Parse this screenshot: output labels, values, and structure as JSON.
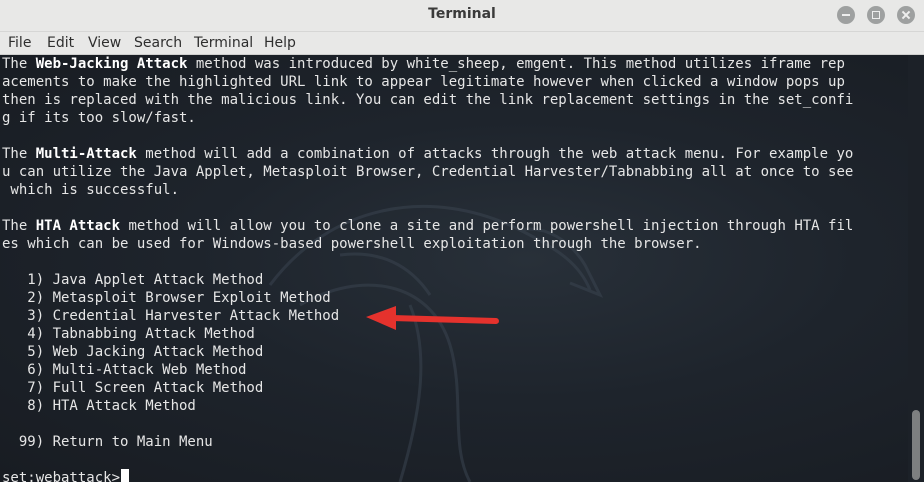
{
  "window": {
    "title": "Terminal",
    "controls": [
      "minimize-icon",
      "maximize-icon",
      "close-icon"
    ]
  },
  "menu": [
    "File",
    "Edit",
    "View",
    "Search",
    "Terminal",
    "Help"
  ],
  "terminal": {
    "l1a": "The ",
    "l1b": "Web-Jacking Attack",
    "l1c": " method was introduced by white_sheep, emgent. This method utilizes iframe rep",
    "l2": "acements to make the highlighted URL link to appear legitimate however when clicked a window pops up",
    "l3": "then is replaced with the malicious link. You can edit the link replacement settings in the set_confi",
    "l4": "g if its too slow/fast.",
    "l5a": "The ",
    "l5b": "Multi-Attack",
    "l5c": " method will add a combination of attacks through the web attack menu. For example yo",
    "l6": "u can utilize the Java Applet, Metasploit Browser, Credential Harvester/Tabnabbing all at once to see",
    " l7": "",
    "l7": " which is successful.",
    "l8a": "The ",
    "l8b": "HTA Attack",
    "l8c": " method will allow you to clone a site and perform powershell injection through HTA fil",
    "l9": "es which can be used for Windows-based powershell exploitation through the browser.",
    "options": [
      "   1) Java Applet Attack Method",
      "   2) Metasploit Browser Exploit Method",
      "   3) Credential Harvester Attack Method",
      "   4) Tabnabbing Attack Method",
      "   5) Web Jacking Attack Method",
      "   6) Multi-Attack Web Method",
      "   7) Full Screen Attack Method",
      "   8) HTA Attack Method"
    ],
    "return_option": "  99) Return to Main Menu",
    "prompt": "set:webattack>"
  },
  "colors": {
    "annotation_arrow": "#e5322d",
    "terminal_bg": "#1c2128",
    "text": "#e6e6e6"
  }
}
